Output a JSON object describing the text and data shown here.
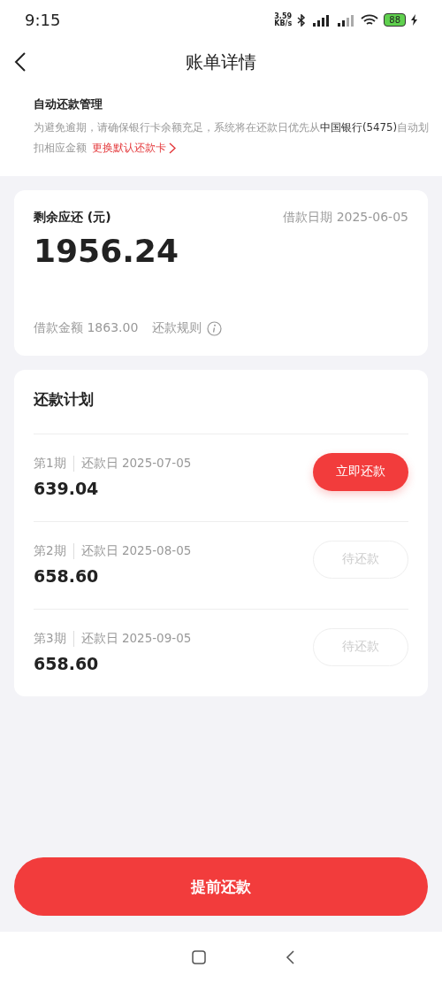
{
  "status_bar": {
    "time": "9:15",
    "speed_value": "3.59",
    "speed_unit": "KB/s",
    "battery": "88"
  },
  "header": {
    "title": "账单详情"
  },
  "auto_repay": {
    "title": "自动还款管理",
    "description": "为避免逾期，请确保银行卡余额充足，系统将在还款日优先从**中国银行(5475)**自动划扣相应金额",
    "link": "更换默认还款卡"
  },
  "summary": {
    "label": "剩余应还 (元)",
    "date_label": "借款日期",
    "date": "2025-06-05",
    "amount": "1956.24",
    "loan_label": "借款金额",
    "loan_amount": "1863.00",
    "rules": "还款规则"
  },
  "plan": {
    "title": "还款计划",
    "installments": [
      {
        "period": "第1期",
        "due_label": "还款日",
        "due_date": "2025-07-05",
        "amount": "639.04",
        "button": "立即还款",
        "disabled": false
      },
      {
        "period": "第2期",
        "due_label": "还款日",
        "due_date": "2025-08-05",
        "amount": "658.60",
        "button": "待还款",
        "disabled": true
      },
      {
        "period": "第3期",
        "due_label": "还款日",
        "due_date": "2025-09-05",
        "amount": "658.60",
        "button": "待还款",
        "disabled": true
      }
    ]
  },
  "prepay_button": "提前还款"
}
